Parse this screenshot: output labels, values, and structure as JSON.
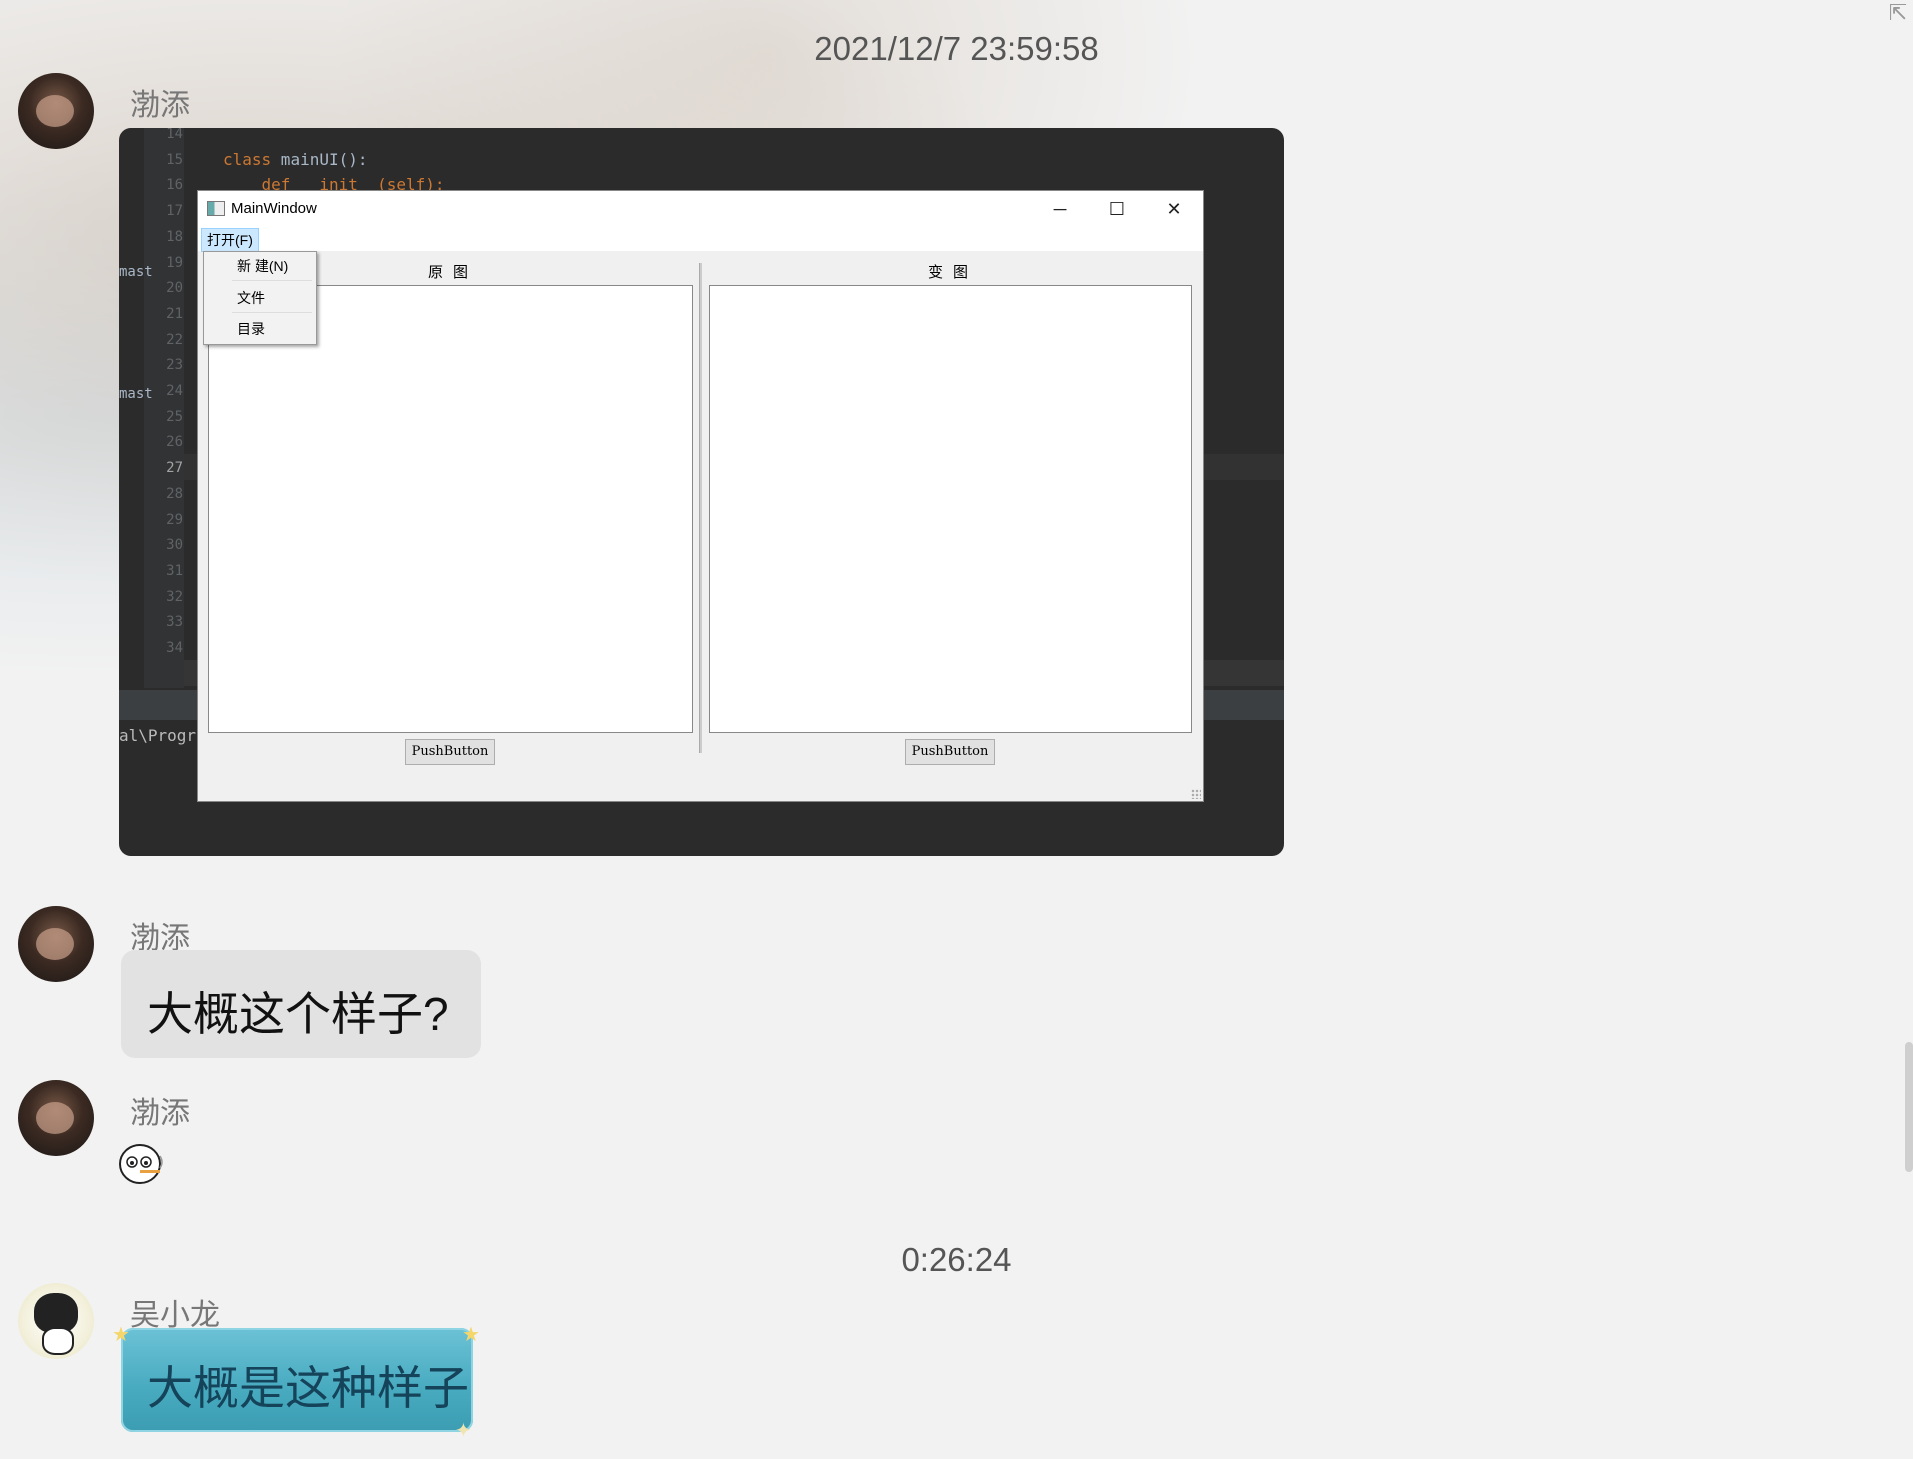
{
  "messages": {
    "time1": "2021/12/7 23:59:58",
    "time2": "0:26:24",
    "sender1": "渤添",
    "sender2": "渤添",
    "sender3": "渤添",
    "sender4": "吴小龙",
    "text1": "大概这个样子?",
    "text2": "大概是这种样子"
  },
  "ide": {
    "line_numbers": [
      "14",
      "15",
      "16",
      "17",
      "18",
      "19",
      "20",
      "21",
      "22",
      "23",
      "24",
      "25",
      "26",
      "27",
      "28",
      "29",
      "30",
      "31",
      "32",
      "33",
      "34"
    ],
    "code_line15_kw": "class",
    "code_line15_rest": " mainUI():",
    "code_line16": "    def __init__(self):",
    "side_text1": "mast",
    "side_text2": "mast",
    "terminal_text": "al\\Progr"
  },
  "qt_window": {
    "title": "MainWindow",
    "minimize": "─",
    "maximize": "☐",
    "close": "✕",
    "menu_open": "打开(F)",
    "menu_items": [
      "新 建(N)",
      "文件",
      "目录"
    ],
    "label_left": "原图",
    "label_right": "变图",
    "button_left": "PushButton",
    "button_right": "PushButton"
  },
  "icons": {
    "corner": "pin-icon",
    "sticker": "smoking-face-sticker"
  }
}
